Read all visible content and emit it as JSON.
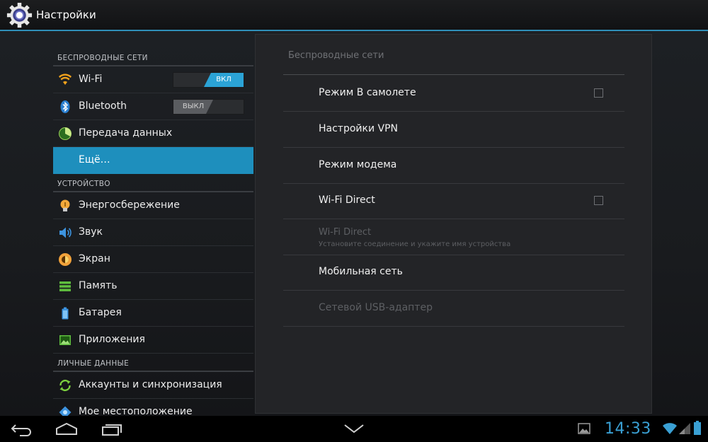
{
  "action_bar": {
    "title": "Настройки",
    "icon": "settings-gear-icon"
  },
  "sidebar": {
    "sections": [
      {
        "header": "БЕСПРОВОДНЫЕ СЕТИ"
      },
      {
        "header": "УСТРОЙСТВО"
      },
      {
        "header": "ЛИЧНЫЕ ДАННЫЕ"
      }
    ],
    "items": [
      {
        "label": "Wi-Fi",
        "icon": "wifi-icon",
        "toggle": "ВКЛ",
        "toggle_state": "on"
      },
      {
        "label": "Bluetooth",
        "icon": "bluetooth-icon",
        "toggle": "ВЫКЛ",
        "toggle_state": "off"
      },
      {
        "label": "Передача данных",
        "icon": "data-usage-icon"
      },
      {
        "label": "Ещё…",
        "selected": true
      },
      {
        "label": "Энергосбережение",
        "icon": "power-saving-icon"
      },
      {
        "label": "Звук",
        "icon": "sound-icon"
      },
      {
        "label": "Экран",
        "icon": "display-icon"
      },
      {
        "label": "Память",
        "icon": "storage-icon"
      },
      {
        "label": "Батарея",
        "icon": "battery-icon"
      },
      {
        "label": "Приложения",
        "icon": "apps-icon"
      },
      {
        "label": "Аккаунты и синхронизация",
        "icon": "sync-icon"
      },
      {
        "label": "Мое местоположение",
        "icon": "location-icon"
      }
    ]
  },
  "panel": {
    "title": "Беспроводные сети",
    "prefs": [
      {
        "title": "Режим В самолете",
        "checkbox": true,
        "checked": false
      },
      {
        "title": "Настройки VPN"
      },
      {
        "title": "Режим модема"
      },
      {
        "title": "Wi-Fi Direct",
        "checkbox": true,
        "checked": false
      },
      {
        "title": "Wi-Fi Direct",
        "summary": "Установите соединение и укажите имя устройства",
        "disabled": true
      },
      {
        "title": "Мобильная сеть"
      },
      {
        "title": "Сетевой USB-адаптер",
        "disabled": true
      }
    ]
  },
  "system_bar": {
    "clock": "14:33",
    "accent": "#3aa0d4",
    "nav": [
      "back-icon",
      "home-icon",
      "recent-apps-icon",
      "hide-keyboard-icon"
    ],
    "status": [
      "gallery-notification-icon",
      "wifi-status-icon",
      "signal-icon",
      "battery-status-icon"
    ]
  },
  "colors": {
    "accent": "#1e8fbd",
    "toggle_on": "#2ba3d6",
    "clock": "#3aa0d4"
  }
}
